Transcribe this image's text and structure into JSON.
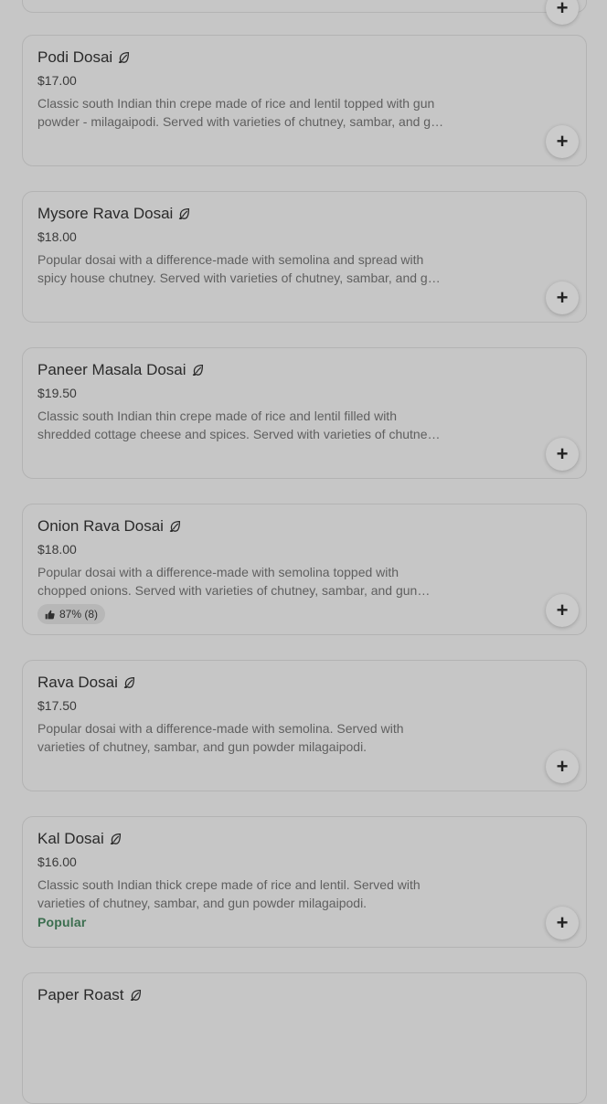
{
  "menu_items": [
    {
      "name": "Podi Dosai",
      "price": "$17.00",
      "description": "Classic south Indian thin crepe made of rice and lentil topped with gun powder - milagaipodi. Served with varieties of chutney, sambar, and gun powder milagaipodi."
    },
    {
      "name": "Mysore Rava Dosai",
      "price": "$18.00",
      "description": "Popular dosai with a difference-made with semolina and spread with spicy house chutney. Served with varieties of chutney, sambar, and gun powder milagaipodi."
    },
    {
      "name": "Paneer Masala Dosai",
      "price": "$19.50",
      "description": "Classic south Indian thin crepe made of rice and lentil filled with shredded cottage cheese and spices. Served with varieties of chutney, sambar, and gun powder milagaipodi."
    },
    {
      "name": "Onion Rava Dosai",
      "price": "$18.00",
      "description": "Popular dosai with a difference-made with semolina topped with chopped onions. Served with varieties of chutney, sambar, and gun powder milagaipodi.",
      "rating": "87% (8)"
    },
    {
      "name": "Rava Dosai",
      "price": "$17.50",
      "description": "Popular dosai with a difference-made with semolina. Served with varieties of chutney, sambar, and gun powder milagaipodi."
    },
    {
      "name": "Kal Dosai",
      "price": "$16.00",
      "description": "Classic south Indian thick crepe made of rice and lentil. Served with varieties of chutney, sambar, and gun powder milagaipodi.",
      "badge": "Popular"
    },
    {
      "name": "Paper Roast"
    }
  ],
  "add_button_symbol": "+",
  "icons": {
    "vegetarian": "leaf-icon",
    "add": "plus-icon",
    "rating": "thumbs-up-icon"
  },
  "colors": {
    "badge_popular": "#3b6e4f"
  }
}
